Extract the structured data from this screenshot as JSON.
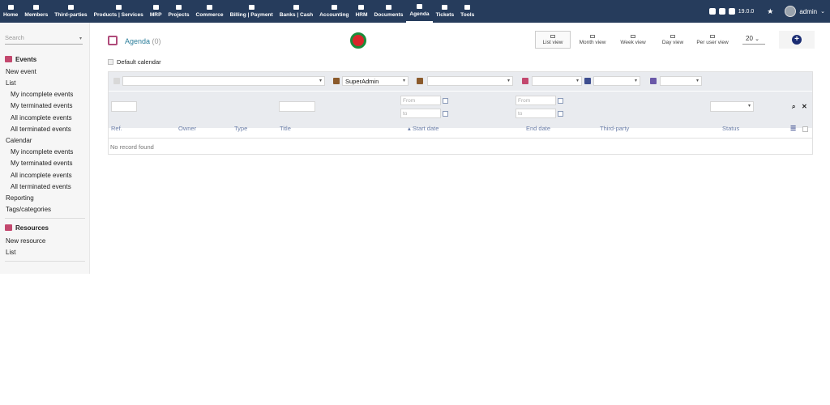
{
  "menu": [
    {
      "label": "Home",
      "icon": "home-icon"
    },
    {
      "label": "Members",
      "icon": "members-icon"
    },
    {
      "label": "Third-parties",
      "icon": "building-icon"
    },
    {
      "label": "Products | Services",
      "icon": "cube-icon"
    },
    {
      "label": "MRP",
      "icon": "cubes-icon"
    },
    {
      "label": "Projects",
      "icon": "sitemap-icon"
    },
    {
      "label": "Commerce",
      "icon": "suitcase-icon"
    },
    {
      "label": "Billing | Payment",
      "icon": "invoice-icon"
    },
    {
      "label": "Banks | Cash",
      "icon": "bank-icon"
    },
    {
      "label": "Accounting",
      "icon": "search-dollar-icon"
    },
    {
      "label": "HRM",
      "icon": "user-tie-icon"
    },
    {
      "label": "Documents",
      "icon": "folder-icon"
    },
    {
      "label": "Agenda",
      "icon": "calendar-icon",
      "active": true
    },
    {
      "label": "Tickets",
      "icon": "ticket-icon"
    },
    {
      "label": "Tools",
      "icon": "tools-icon"
    }
  ],
  "topright": {
    "version": "19.0.0",
    "user": "admin"
  },
  "sidebar": {
    "search_placeholder": "Search",
    "events_title": "Events",
    "new_event": "New event",
    "list": "List",
    "list_items": [
      "My incomplete events",
      "My terminated events",
      "All incomplete events",
      "All terminated events"
    ],
    "calendar": "Calendar",
    "calendar_items": [
      "My incomplete events",
      "My terminated events",
      "All incomplete events",
      "All terminated events"
    ],
    "reporting": "Reporting",
    "tags": "Tags/categories",
    "resources_title": "Resources",
    "new_resource": "New resource",
    "resource_list": "List"
  },
  "main": {
    "title": "Agenda",
    "count": "(0)",
    "views": [
      "List view",
      "Month view",
      "Week view",
      "Day view",
      "Per user view"
    ],
    "active_view": "List view",
    "limit": "20",
    "default_calendar": "Default calendar",
    "filter_user": "SuperAdmin",
    "date_from": "From",
    "date_to": "to",
    "columns": [
      "Ref.",
      "Owner",
      "Type",
      "Title",
      "Start date",
      "End date",
      "Third-party",
      "Status"
    ],
    "sort_column": "Start date",
    "empty_message": "No record found"
  },
  "colors": {
    "topbar": "#263c5c",
    "accent": "#2a7d9a",
    "agenda_icon": "#b04b7a",
    "add_button": "#1b2d73"
  }
}
